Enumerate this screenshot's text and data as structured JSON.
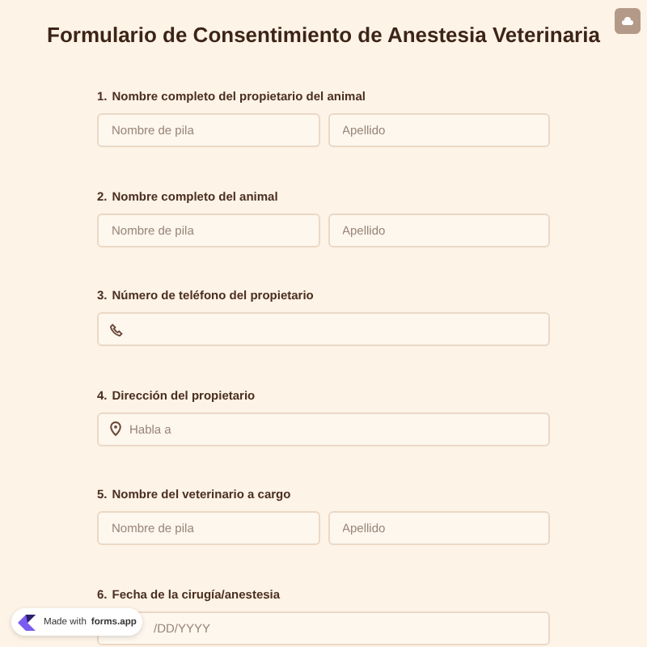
{
  "title": "Formulario de Consentimiento de Anestesia Veterinaria",
  "questions": [
    {
      "number": "1.",
      "label": "Nombre completo del propietario del animal",
      "fields": [
        {
          "kind": "text",
          "placeholder": "Nombre de pila"
        },
        {
          "kind": "text",
          "placeholder": "Apellido"
        }
      ]
    },
    {
      "number": "2.",
      "label": "Nombre completo del animal",
      "fields": [
        {
          "kind": "text",
          "placeholder": "Nombre de pila"
        },
        {
          "kind": "text",
          "placeholder": "Apellido"
        }
      ]
    },
    {
      "number": "3.",
      "label": "Número de teléfono del propietario",
      "fields": [
        {
          "kind": "phone"
        }
      ]
    },
    {
      "number": "4.",
      "label": "Dirección del propietario",
      "fields": [
        {
          "kind": "address",
          "placeholder": "Habla a"
        }
      ]
    },
    {
      "number": "5.",
      "label": "Nombre del veterinario a cargo",
      "fields": [
        {
          "kind": "text",
          "placeholder": "Nombre de pila"
        },
        {
          "kind": "text",
          "placeholder": "Apellido"
        }
      ]
    },
    {
      "number": "6.",
      "label": "Fecha de la cirugía/anestesia",
      "fields": [
        {
          "kind": "date",
          "placeholder": "/DD/YYYY"
        }
      ]
    }
  ],
  "badge": {
    "prefix": "Made with",
    "brand": "forms.app"
  }
}
